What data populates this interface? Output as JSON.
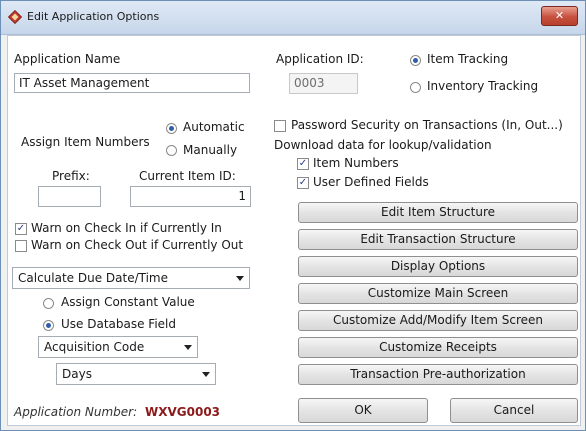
{
  "window": {
    "title": "Edit Application Options",
    "close_glyph": "✕",
    "icon": "app-diamond-icon"
  },
  "app": {
    "name_label": "Application Name",
    "name_value": "IT Asset Management",
    "id_label": "Application ID:",
    "id_value": "0003",
    "tracking_options": [
      "Item Tracking",
      "Inventory Tracking"
    ],
    "tracking_selected": "Item Tracking"
  },
  "item_numbers": {
    "label": "Assign Item Numbers",
    "options": [
      "Automatic",
      "Manually"
    ],
    "selected": "Automatic",
    "prefix_label": "Prefix:",
    "prefix_value": "",
    "current_label": "Current Item ID:",
    "current_value": "1"
  },
  "warnings": {
    "check_in_label": "Warn on Check In if Currently In",
    "check_in_checked": true,
    "check_out_label": "Warn on Check Out if Currently Out",
    "check_out_checked": false
  },
  "due_date": {
    "selected": "Calculate Due Date/Time",
    "method_options": [
      "Assign Constant Value",
      "Use Database Field"
    ],
    "method_selected": "Use Database Field",
    "field_value": "Acquisition Code",
    "unit_value": "Days"
  },
  "security": {
    "password_label": "Password Security on Transactions (In, Out...)",
    "password_checked": false,
    "download_label": "Download data for lookup/validation",
    "item_numbers_label": "Item Numbers",
    "item_numbers_checked": true,
    "user_fields_label": "User Defined Fields",
    "user_fields_checked": true
  },
  "buttons": {
    "edit_item": "Edit Item Structure",
    "edit_transaction": "Edit Transaction Structure",
    "display_options": "Display Options",
    "customize_main": "Customize Main Screen",
    "customize_add_modify": "Customize Add/Modify Item Screen",
    "customize_receipts": "Customize Receipts",
    "pre_auth": "Transaction Pre-authorization",
    "ok": "OK",
    "cancel": "Cancel"
  },
  "footer": {
    "app_number_label": "Application Number:",
    "app_number_value": "WXVG0003"
  },
  "check_glyph": "✓",
  "colors": {
    "titlebar": "#c6d6ea",
    "close": "#c75040",
    "app_number": "#8b1a1a",
    "radio_dot": "#2f5fa8"
  }
}
